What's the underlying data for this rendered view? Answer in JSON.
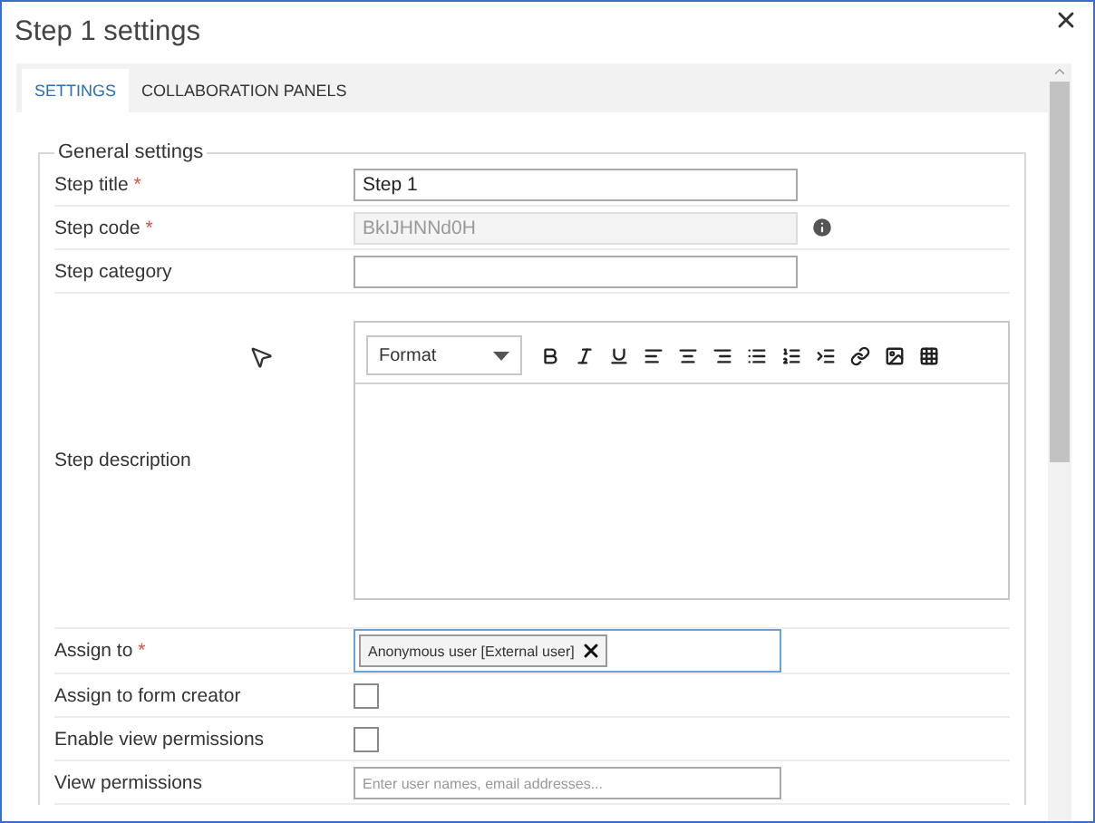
{
  "window": {
    "title": "Step 1 settings"
  },
  "tabs": [
    {
      "label": "SETTINGS",
      "selected": true
    },
    {
      "label": "COLLABORATION PANELS",
      "selected": false
    }
  ],
  "section": {
    "legend": "General settings"
  },
  "required_marker": "*",
  "fields": [
    {
      "kind": "text",
      "label": "Step title",
      "required": true,
      "value": "Step 1",
      "disabled": false,
      "info": false
    },
    {
      "kind": "text",
      "label": "Step code",
      "required": true,
      "value": "BkIJHNNd0H",
      "disabled": true,
      "info": true
    },
    {
      "kind": "text",
      "label": "Step category",
      "required": false,
      "disabled": false,
      "info": false
    },
    {
      "kind": "editor",
      "label": "Step description",
      "required": false,
      "format": "Format"
    },
    {
      "kind": "tags",
      "label": "Assign to",
      "required": true,
      "tags": [
        "Anonymous user [External user]"
      ]
    },
    {
      "kind": "checkbox",
      "label": "Assign to form creator",
      "required": false,
      "checked": false
    },
    {
      "kind": "checkbox",
      "label": "Enable view permissions",
      "required": false,
      "checked": false
    },
    {
      "kind": "people",
      "label": "View permissions",
      "required": false,
      "placeholder": "Enter user names, email addresses..."
    }
  ]
}
